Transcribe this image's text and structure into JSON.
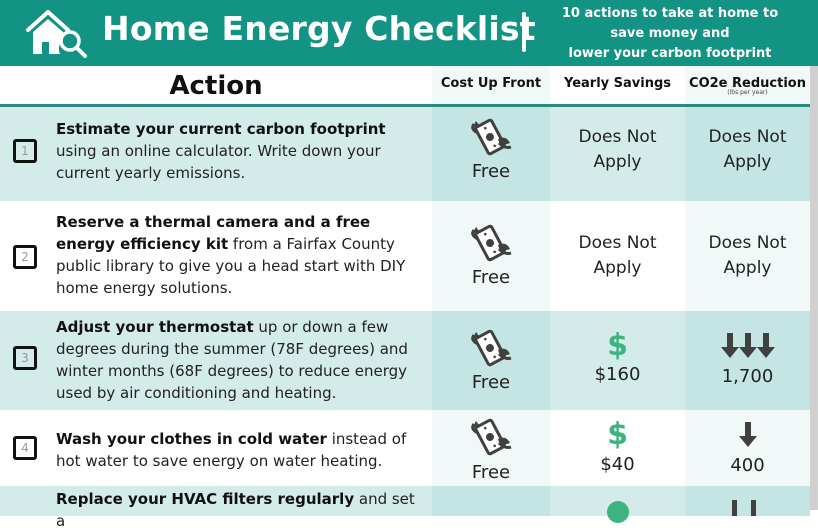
{
  "header": {
    "title": "Home Energy Checklist",
    "logo_icon": "home-search-icon",
    "tagline": [
      "10 actions to take at home to",
      "save money and",
      "lower your carbon footprint"
    ]
  },
  "table": {
    "columns": {
      "action": "Action",
      "cost": "Cost Up Front",
      "savings": "Yearly Savings",
      "co2": "CO2e Reduction",
      "co2_unit": "(lbs per year)"
    },
    "rows": [
      {
        "number": "1",
        "bold": "Estimate your current carbon footprint",
        "rest": " using an online calculator. Write down your current yearly emissions.",
        "cost_icon": "flying-money-icon",
        "cost": "Free",
        "savings": [
          "Does Not",
          "Apply"
        ],
        "co2": [
          "Does Not",
          "Apply"
        ]
      },
      {
        "number": "2",
        "bold": "Reserve a thermal camera and a free energy efficiency kit",
        "rest": " from a Fairfax County public library to give you a head start with DIY home energy solutions.",
        "cost_icon": "flying-money-icon",
        "cost": "Free",
        "savings": [
          "Does Not",
          "Apply"
        ],
        "co2": [
          "Does Not",
          "Apply"
        ]
      },
      {
        "number": "3",
        "bold": "Adjust your thermostat",
        "rest": " up or down a few degrees during the summer (78F degrees) and winter months (68F degrees) to reduce energy used by air conditioning and heating.",
        "cost_icon": "flying-money-icon",
        "cost": "Free",
        "savings_icon": "$",
        "savings_value": "$160",
        "co2_arrows": 3,
        "co2_value": "1,700"
      },
      {
        "number": "4",
        "bold": "Wash your clothes in cold water",
        "rest": " instead of hot water to save energy on water heating.",
        "cost_icon": "flying-money-icon",
        "cost": "Free",
        "savings_icon": "$",
        "savings_value": "$40",
        "co2_arrows": 1,
        "co2_value": "400"
      },
      {
        "bold": "Replace your HVAC filters regularly",
        "rest": " and set a"
      }
    ]
  },
  "colors": {
    "brand_teal": "#129383",
    "row_shade": "#d3ebe9",
    "dollar_green": "#3db380",
    "arrow_gray": "#404040"
  }
}
